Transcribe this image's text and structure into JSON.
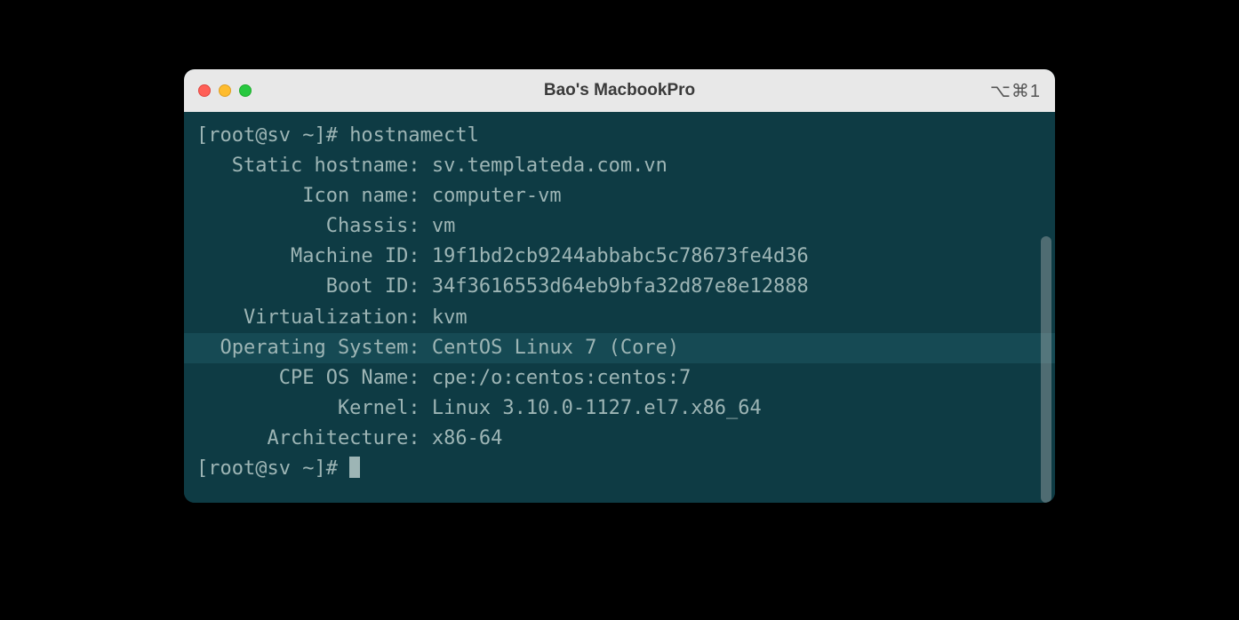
{
  "window": {
    "title": "Bao's MacbookPro",
    "shortcut_hint": "⌥⌘1"
  },
  "terminal": {
    "prompt1": "[root@sv ~]# ",
    "command1": "hostnamectl",
    "prompt2": "[root@sv ~]# ",
    "lines": [
      {
        "label": "   Static hostname:",
        "value": " sv.templateda.com.vn",
        "highlighted": false
      },
      {
        "label": "         Icon name:",
        "value": " computer-vm",
        "highlighted": false
      },
      {
        "label": "           Chassis:",
        "value": " vm",
        "highlighted": false
      },
      {
        "label": "        Machine ID:",
        "value": " 19f1bd2cb9244abbabc5c78673fe4d36",
        "highlighted": false
      },
      {
        "label": "           Boot ID:",
        "value": " 34f3616553d64eb9bfa32d87e8e12888",
        "highlighted": false
      },
      {
        "label": "    Virtualization:",
        "value": " kvm",
        "highlighted": false
      },
      {
        "label": "  Operating System:",
        "value": " CentOS Linux 7 (Core)",
        "highlighted": true
      },
      {
        "label": "       CPE OS Name:",
        "value": " cpe:/o:centos:centos:7",
        "highlighted": false
      },
      {
        "label": "            Kernel:",
        "value": " Linux 3.10.0-1127.el7.x86_64",
        "highlighted": false
      },
      {
        "label": "      Architecture:",
        "value": " x86-64",
        "highlighted": false
      }
    ]
  }
}
